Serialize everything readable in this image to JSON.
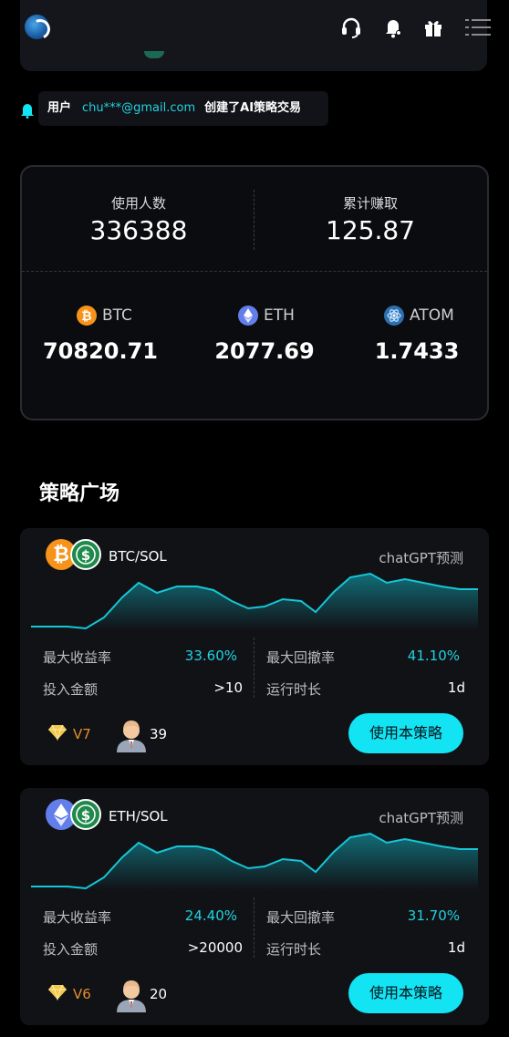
{
  "notice": {
    "user_label": "用户",
    "email": "chu***@gmail.com",
    "action": "创建了AI策略交易"
  },
  "stats": {
    "users_label": "使用人数",
    "users_value": "336388",
    "earned_label": "累计赚取",
    "earned_value": "125.87",
    "coins": [
      {
        "symbol": "BTC",
        "price": "70820.71",
        "color": "#f7931a",
        "icon": "bitcoin-icon"
      },
      {
        "symbol": "ETH",
        "price": "2077.69",
        "color": "#627eea",
        "icon": "ethereum-icon"
      },
      {
        "symbol": "ATOM",
        "price": "1.7433",
        "color": "#2e6fb0",
        "icon": "atom-icon"
      }
    ]
  },
  "section": {
    "title": "策略广场"
  },
  "strategies": [
    {
      "pair": "BTC/SOL",
      "predict": "chatGPT预测",
      "max_return_label": "最大收益率",
      "max_return": "33.60%",
      "max_drawdown_label": "最大回撤率",
      "max_drawdown": "41.10%",
      "invest_label": "投入金额",
      "invest": ">10",
      "duration_label": "运行时长",
      "duration": "1d",
      "level": "V7",
      "users": "39",
      "button": "使用本策略"
    },
    {
      "pair": "ETH/SOL",
      "predict": "chatGPT预测",
      "max_return_label": "最大收益率",
      "max_return": "24.40%",
      "max_drawdown_label": "最大回撤率",
      "max_drawdown": "31.70%",
      "invest_label": "投入金额",
      "invest": ">20000",
      "duration_label": "运行时长",
      "duration": "1d",
      "level": "V6",
      "users": "20",
      "button": "使用本策略"
    }
  ],
  "colors": {
    "accent": "#12e4f4",
    "cyan_text": "#21d3e0",
    "level": "#e38d2e"
  }
}
